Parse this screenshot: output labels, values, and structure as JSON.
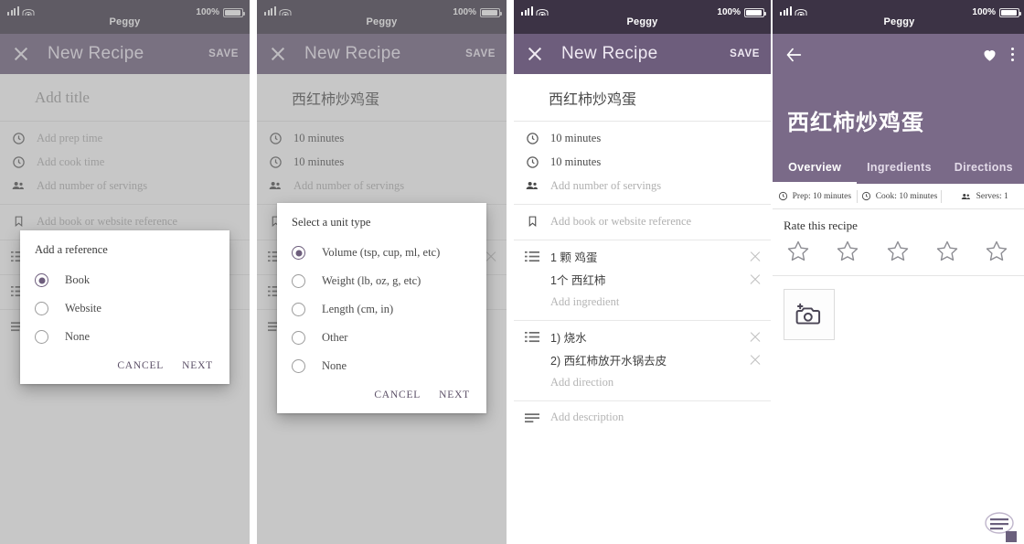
{
  "status_bar": {
    "carrier": "Peggy",
    "battery_percent": "100%"
  },
  "panels": [
    {
      "id": "new-recipe-reference-dialog",
      "appbar": {
        "close_icon": "close-icon",
        "title": "New Recipe",
        "save_label": "SAVE"
      },
      "title_field": {
        "value": "",
        "placeholder": "Add title"
      },
      "fields": [
        {
          "icon": "clock-icon",
          "value": "",
          "placeholder": "Add prep time"
        },
        {
          "icon": "clock-icon",
          "value": "",
          "placeholder": "Add cook time"
        },
        {
          "icon": "people-icon",
          "value": "",
          "placeholder": "Add number of servings"
        },
        {
          "icon": "bookmark-icon",
          "value": "",
          "placeholder": "Add book or website reference"
        }
      ],
      "dialog": {
        "title": "Add a reference",
        "options": [
          "Book",
          "Website",
          "None"
        ],
        "selected_index": 0,
        "cancel_label": "CANCEL",
        "next_label": "NEXT"
      }
    },
    {
      "id": "new-recipe-unit-dialog",
      "appbar": {
        "close_icon": "close-icon",
        "title": "New Recipe",
        "save_label": "SAVE"
      },
      "title_field": {
        "value": "西红柿炒鸡蛋",
        "placeholder": "Add title"
      },
      "fields": [
        {
          "icon": "clock-icon",
          "value": "10 minutes",
          "placeholder": "Add prep time"
        },
        {
          "icon": "clock-icon",
          "value": "10 minutes",
          "placeholder": "Add cook time"
        },
        {
          "icon": "people-icon",
          "value": "",
          "placeholder": "Add number of servings"
        },
        {
          "icon": "bookmark-icon",
          "value": "",
          "placeholder": "Add book or website reference"
        }
      ],
      "dialog": {
        "title": "Select a unit type",
        "options": [
          "Volume (tsp, cup, ml, etc)",
          "Weight (lb, oz, g, etc)",
          "Length (cm, in)",
          "Other",
          "None"
        ],
        "selected_index": 0,
        "cancel_label": "CANCEL",
        "next_label": "NEXT"
      }
    },
    {
      "id": "new-recipe-filled",
      "appbar": {
        "close_icon": "close-icon",
        "title": "New Recipe",
        "save_label": "SAVE"
      },
      "title_field": {
        "value": "西红柿炒鸡蛋",
        "placeholder": "Add title"
      },
      "fields": [
        {
          "icon": "clock-icon",
          "value": "10 minutes",
          "placeholder": "Add prep time"
        },
        {
          "icon": "clock-icon",
          "value": "10 minutes",
          "placeholder": "Add cook time"
        },
        {
          "icon": "people-icon",
          "value": "",
          "placeholder": "Add number of servings"
        },
        {
          "icon": "bookmark-icon",
          "value": "",
          "placeholder": "Add book or website reference"
        }
      ],
      "ingredients": {
        "icon": "list-icon",
        "items": [
          "1 颗 鸡蛋",
          "1个 西红柿"
        ],
        "placeholder": "Add ingredient"
      },
      "directions": {
        "icon": "numbered-list-icon",
        "items": [
          "1) 烧水",
          "2) 西红柿放开水锅去皮"
        ],
        "placeholder": "Add direction"
      },
      "description": {
        "icon": "description-icon",
        "placeholder": "Add description"
      }
    },
    {
      "id": "recipe-detail",
      "hero": {
        "back_icon": "back-arrow-icon",
        "favorite_icon": "heart-icon",
        "overflow_icon": "more-vertical-icon",
        "title": "西红柿炒鸡蛋"
      },
      "tabs": [
        {
          "label": "Overview",
          "active": true
        },
        {
          "label": "Ingredients",
          "active": false
        },
        {
          "label": "Directions",
          "active": false
        }
      ],
      "meta": [
        {
          "icon": "clock-icon",
          "label": "Prep: 10 minutes"
        },
        {
          "icon": "clock-icon",
          "label": "Cook: 10 minutes"
        },
        {
          "icon": "people-icon",
          "label": "Serves: 1"
        }
      ],
      "rating": {
        "label": "Rate this recipe",
        "stars_total": 5,
        "stars_filled": 0
      },
      "add_photo": {
        "icon": "add-photo-icon"
      }
    }
  ],
  "theme": {
    "status_bar_bg": "#3c3345",
    "app_bar_bg": "#6d5d7c",
    "hero_bg": "#7a6a88",
    "accent": "#6d5d7c",
    "placeholder_text": "#b0b0b0",
    "body_text": "#4a4a4a"
  }
}
